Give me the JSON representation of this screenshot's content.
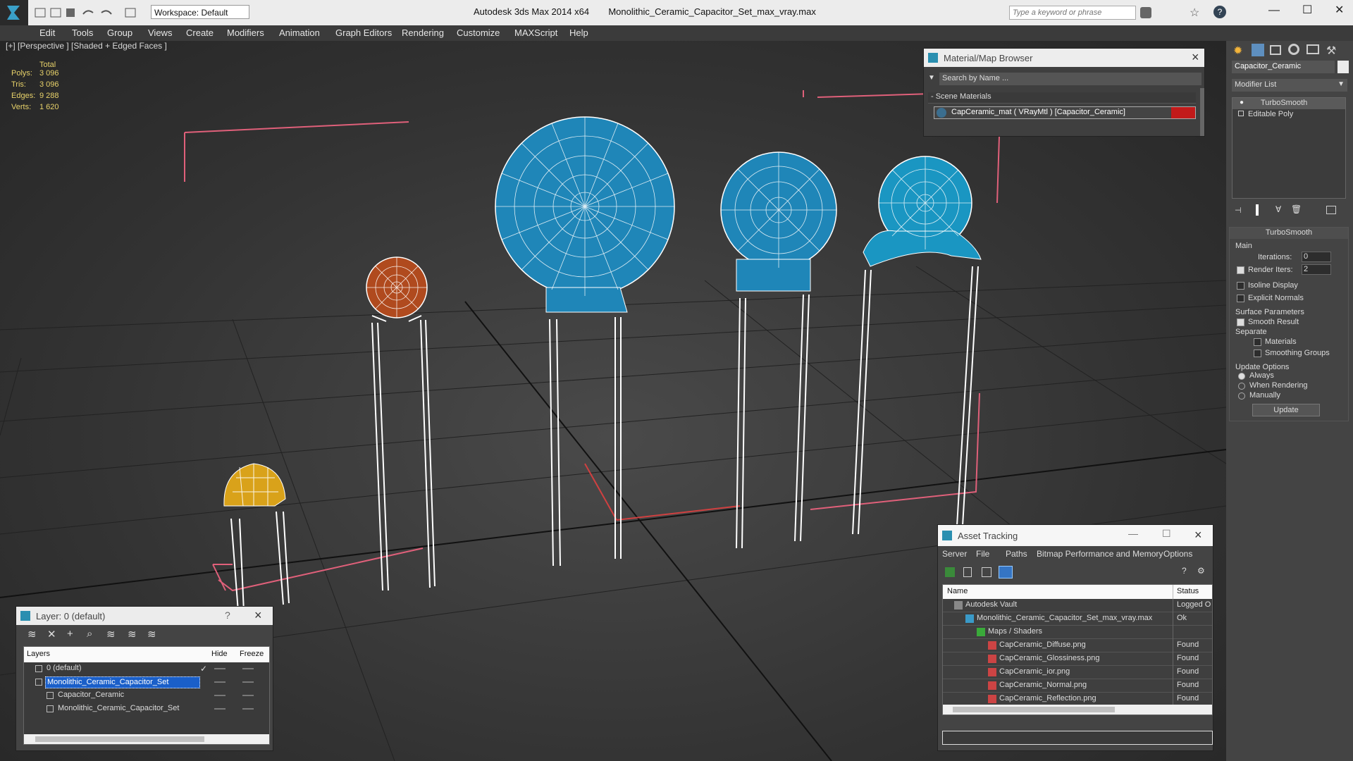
{
  "app": {
    "title": "Autodesk 3ds Max  2014 x64",
    "file": "Monolithic_Ceramic_Capacitor_Set_max_vray.max",
    "workspace": "Workspace: Default",
    "search_placeholder": "Type a keyword or phrase"
  },
  "menu": [
    "Edit",
    "Tools",
    "Group",
    "Views",
    "Create",
    "Modifiers",
    "Animation",
    "Graph Editors",
    "Rendering",
    "Customize",
    "MAXScript",
    "Help"
  ],
  "viewport": {
    "label": "[+] [Perspective ] [Shaded + Edged Faces ]",
    "stats": {
      "header": "Total",
      "rows": [
        {
          "label": "Polys:",
          "value": "3 096"
        },
        {
          "label": "Tris:",
          "value": "3 096"
        },
        {
          "label": "Edges:",
          "value": "9 288"
        },
        {
          "label": "Verts:",
          "value": "1 620"
        }
      ]
    },
    "colors": {
      "blue": "#1f86b8",
      "orange": "#b04a1e",
      "yellow": "#d9a21a",
      "wire": "#ffffff",
      "bbox": "#e0607a"
    }
  },
  "material_browser": {
    "title": "Material/Map Browser",
    "search": "Search by Name ...",
    "section": "- Scene Materials",
    "item": "CapCeramic_mat  ( VRayMtl ) [Capacitor_Ceramic]"
  },
  "asset_tracking": {
    "title": "Asset Tracking",
    "menu": [
      "Server",
      "File",
      "Paths",
      "Bitmap Performance and Memory",
      "Options"
    ],
    "columns": [
      "Name",
      "Status"
    ],
    "rows": [
      {
        "name": "Autodesk Vault",
        "status": "Logged O",
        "indent": 0
      },
      {
        "name": "Monolithic_Ceramic_Capacitor_Set_max_vray.max",
        "status": "Ok",
        "indent": 1
      },
      {
        "name": "Maps / Shaders",
        "status": "",
        "indent": 2
      },
      {
        "name": "CapCeramic_Diffuse.png",
        "status": "Found",
        "indent": 3
      },
      {
        "name": "CapCeramic_Glossiness.png",
        "status": "Found",
        "indent": 3
      },
      {
        "name": "CapCeramic_ior.png",
        "status": "Found",
        "indent": 3
      },
      {
        "name": "CapCeramic_Normal.png",
        "status": "Found",
        "indent": 3
      },
      {
        "name": "CapCeramic_Reflection.png",
        "status": "Found",
        "indent": 3
      }
    ]
  },
  "layer_window": {
    "title": "Layer: 0 (default)",
    "help": "?",
    "columns": [
      "Layers",
      "Hide",
      "Freeze"
    ],
    "rows": [
      {
        "name": "0 (default)",
        "selected": false
      },
      {
        "name": "Monolithic_Ceramic_Capacitor_Set",
        "selected": true
      },
      {
        "name": "Capacitor_Ceramic",
        "selected": false
      },
      {
        "name": "Monolithic_Ceramic_Capacitor_Set",
        "selected": false
      }
    ]
  },
  "command_panel": {
    "object_name": "Capacitor_Ceramic",
    "modifier_list": "Modifier List",
    "stack": [
      "TurboSmooth",
      "Editable Poly"
    ],
    "rollout_title": "TurboSmooth",
    "main": "Main",
    "iterations_label": "Iterations:",
    "iterations": "0",
    "render_iters_label": "Render Iters:",
    "render_iters": "2",
    "isoline": "Isoline Display",
    "explicit_normals": "Explicit Normals",
    "surface_params": "Surface Parameters",
    "smooth_result": "Smooth Result",
    "separate": "Separate",
    "materials": "Materials",
    "smoothing_groups": "Smoothing Groups",
    "update_options": "Update Options",
    "always": "Always",
    "when_rendering": "When Rendering",
    "manually": "Manually",
    "update_button": "Update"
  }
}
